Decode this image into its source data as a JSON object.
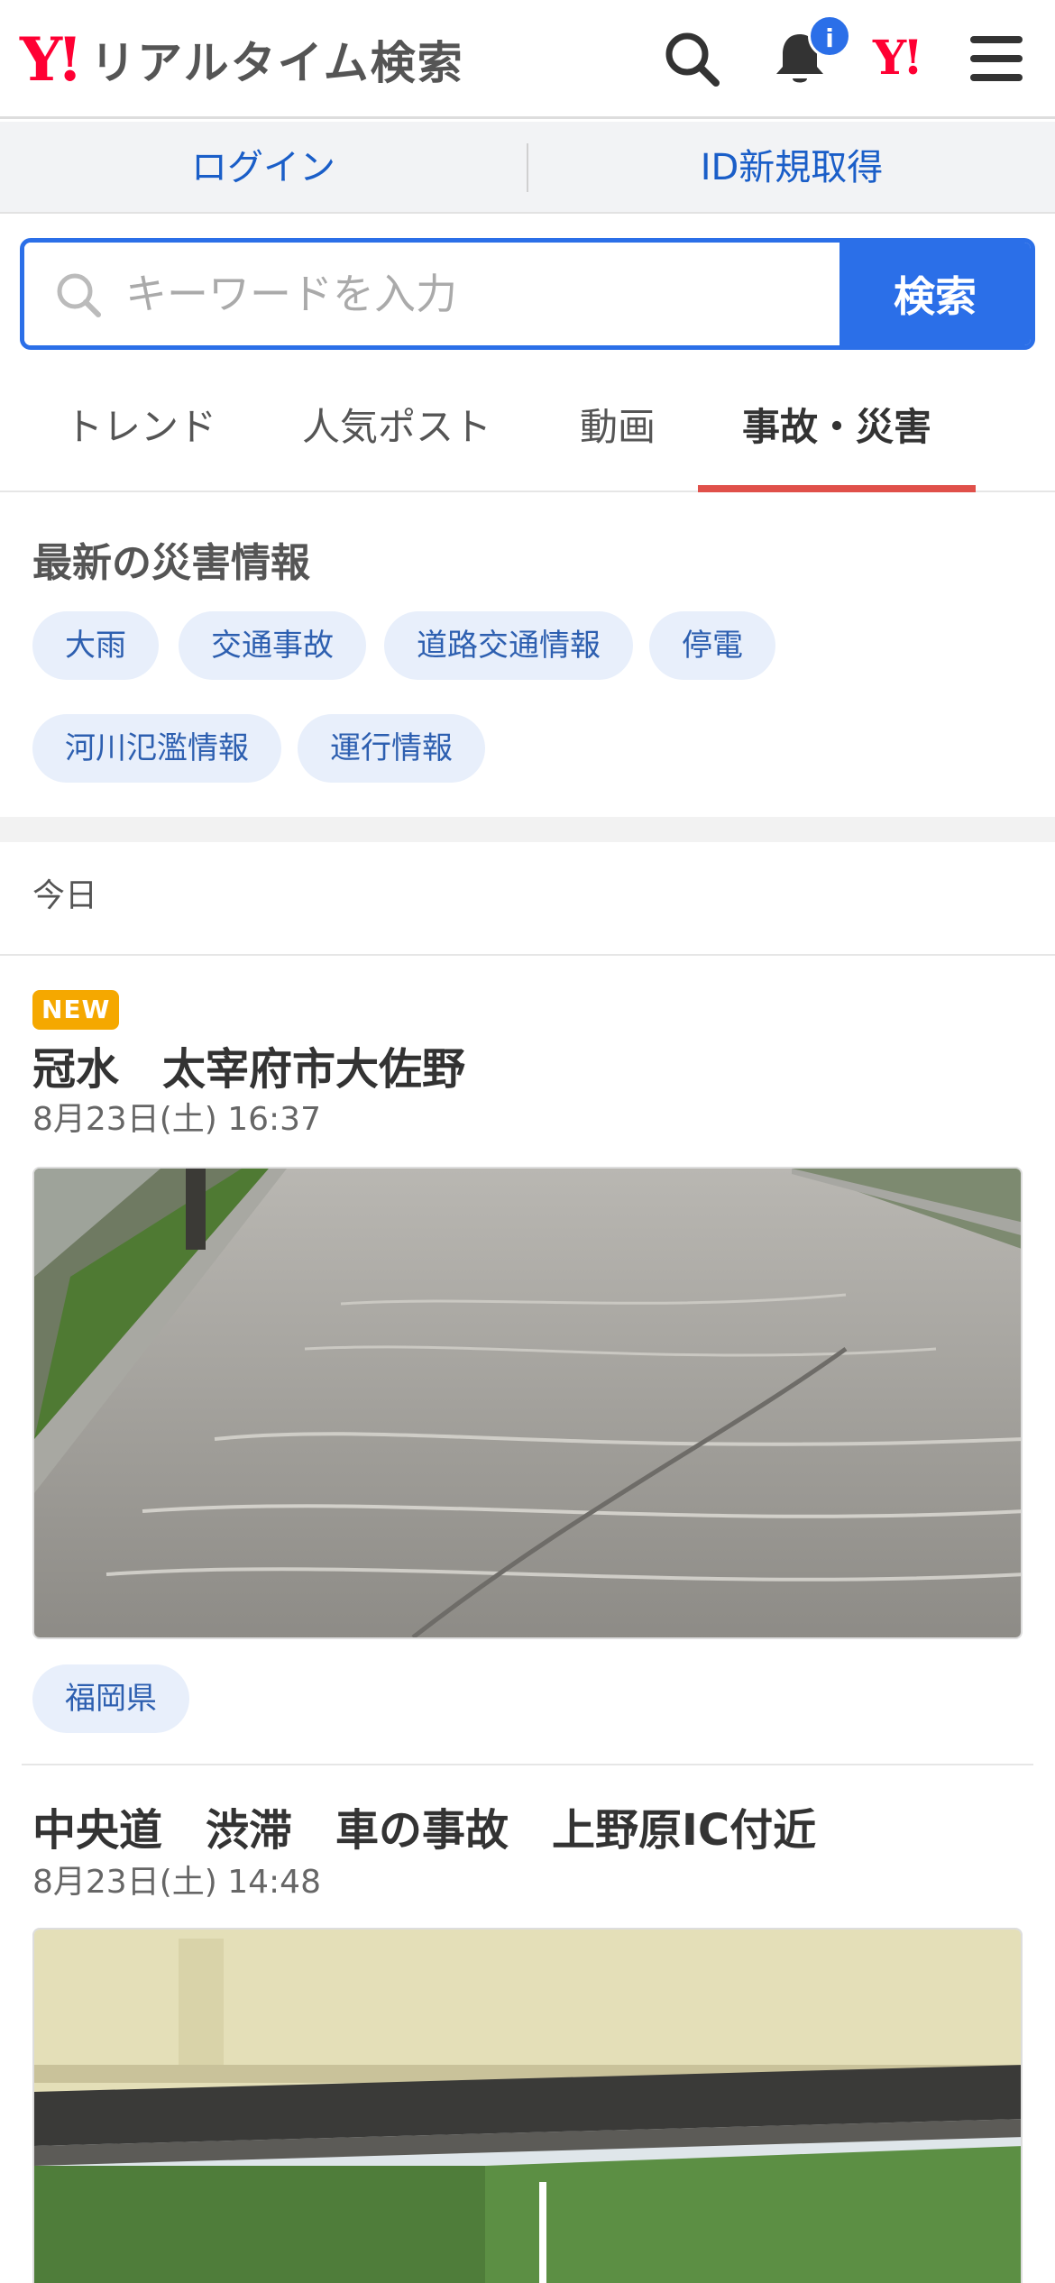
{
  "header": {
    "logo_mark": "Y!",
    "title": "リアルタイム検索",
    "notification_badge": "i",
    "yahoo_mark": "Y!"
  },
  "account": {
    "login": "ログイン",
    "signup": "ID新規取得"
  },
  "search": {
    "placeholder": "キーワードを入力",
    "button": "検索"
  },
  "tabs": [
    {
      "label": "トレンド",
      "active": false
    },
    {
      "label": "人気ポスト",
      "active": false
    },
    {
      "label": "動画",
      "active": false
    },
    {
      "label": "事故・災害",
      "active": true
    }
  ],
  "disaster": {
    "title": "最新の災害情報",
    "chips": [
      "大雨",
      "交通事故",
      "道路交通情報",
      "停電",
      "河川氾濫情報",
      "運行情報"
    ]
  },
  "feed": {
    "day_label": "今日",
    "posts": [
      {
        "badge": "NEW",
        "title": "冠水　太宰府市大佐野",
        "time": "8月23日(土) 16:37",
        "image": "flooded-road-photo",
        "place": "福岡県"
      },
      {
        "title": "中央道　渋滞　車の事故　上野原IC付近",
        "time": "8月23日(土) 14:48",
        "image": "highway-overpass-photo"
      }
    ]
  },
  "colors": {
    "brand_red": "#ff0033",
    "accent_blue": "#2b6fe8",
    "tab_underline": "#e0504a",
    "chip_bg": "#e8effb",
    "new_badge": "#f5a800"
  }
}
